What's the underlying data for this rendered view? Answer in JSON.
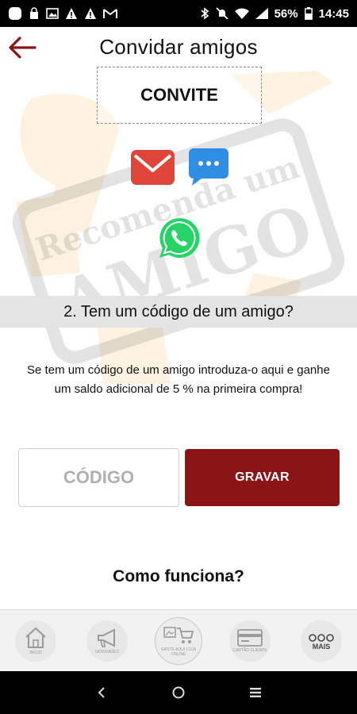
{
  "statusbar": {
    "battery": "56%",
    "time": "14:45"
  },
  "header": {
    "title": "Convidar amigos"
  },
  "invite": {
    "label": "CONVITE"
  },
  "emblem": {
    "line1": "Recomenda um",
    "line2": "AMIGO"
  },
  "share": {
    "email_icon": "email-icon",
    "sms_icon": "message-icon",
    "whatsapp_icon": "whatsapp-icon"
  },
  "section2": {
    "heading": "2. Tem um código de um amigo?",
    "description": "Se tem um código de um amigo introduza-o aqui e ganhe um saldo adicional de 5 % na primeira compra!"
  },
  "form": {
    "code_placeholder": "CÓDIGO",
    "code_value": "",
    "save_label": "GRAVAR"
  },
  "how_it_works": "Como funciona?",
  "bottom_nav": [
    {
      "label": "INÍCIO",
      "icon": "home-icon"
    },
    {
      "label": "NOVIDADES",
      "icon": "megaphone-icon"
    },
    {
      "label": "GASTE AQUI LOJA ONLINE",
      "icon": "cart-icon"
    },
    {
      "label": "CARTÃO CLIENTE",
      "icon": "card-icon"
    },
    {
      "label": "MAIS",
      "icon": "more-icon"
    }
  ],
  "colors": {
    "accent": "#8b1516",
    "email": "#e0453a",
    "sms": "#2f8de4",
    "whatsapp": "#25d366",
    "emblem_orange": "#f5a623"
  }
}
